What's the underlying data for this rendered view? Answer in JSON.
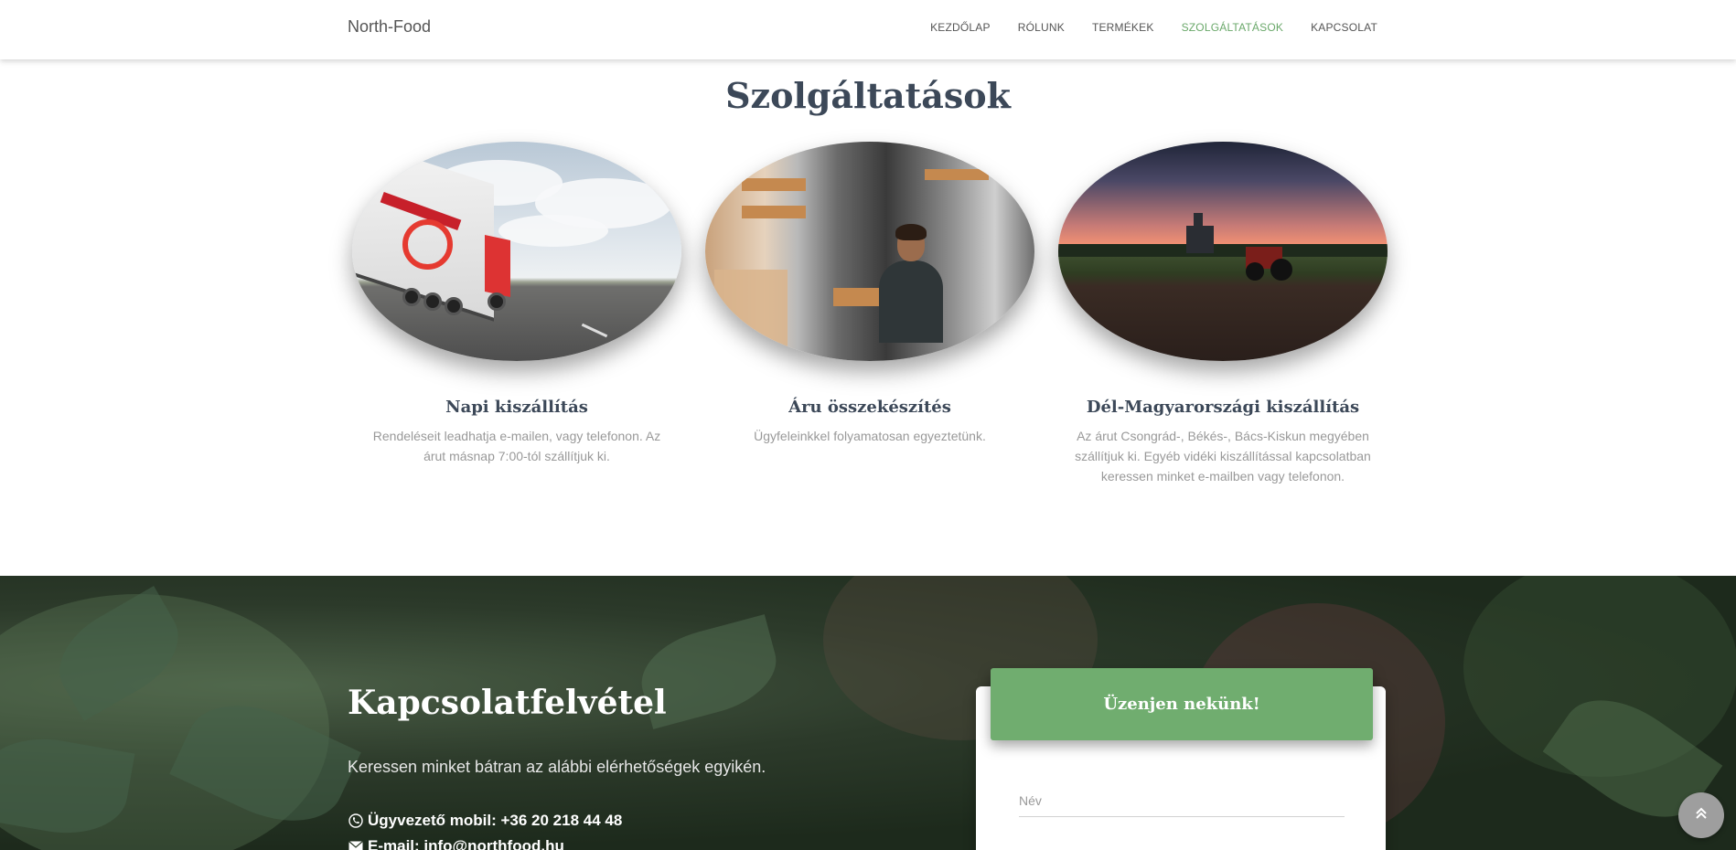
{
  "navbar": {
    "brand": "North-Food",
    "items": [
      {
        "label": "KEZDŐLAP",
        "active": false
      },
      {
        "label": "RÓLUNK",
        "active": false
      },
      {
        "label": "TERMÉKEK",
        "active": false
      },
      {
        "label": "SZOLGÁLTATÁSOK",
        "active": true
      },
      {
        "label": "KAPCSOLAT",
        "active": false
      }
    ]
  },
  "services": {
    "title": "Szolgáltatások",
    "cards": [
      {
        "title": "Napi kiszállítás",
        "text": "Rendeléseit leadhatja e-mailen, vagy telefonon. Az árut másnap 7:00-tól szállítjuk ki."
      },
      {
        "title": "Áru összekészítés",
        "text": "Ügyfeleinkkel folyamatosan egyeztetünk."
      },
      {
        "title": "Dél-Magyarországi kiszállítás",
        "text": "Az árut Csongrád-, Békés-, Bács-Kiskun megyében szállítjuk ki. Egyéb vidéki kiszállítással kapcsolatban keressen minket e-mailben vagy telefonon."
      }
    ]
  },
  "contact": {
    "title": "Kapcsolatfelvétel",
    "subtitle": "Keressen minket bátran az alábbi elérhetőségek egyikén.",
    "phone": "Ügyvezető mobil: +36 20 218 44 48",
    "email": "E-mail: info@northfood.hu"
  },
  "form": {
    "header": "Üzenjen nekünk!",
    "name_placeholder": "Név"
  },
  "colors": {
    "accent": "#70ad6f",
    "nav_active": "#6aa86a",
    "heading": "#3c4858"
  }
}
